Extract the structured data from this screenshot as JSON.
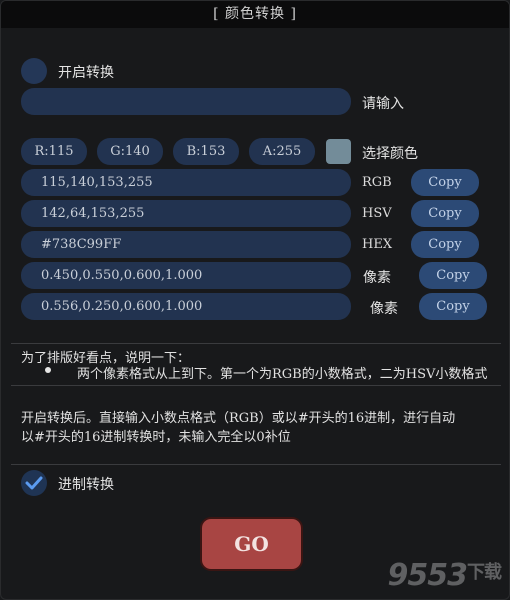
{
  "window": {
    "title": "[ 颜色转换 ]"
  },
  "input_section": {
    "toggle_label": "开启转换",
    "toggle_on": false,
    "input_value": "",
    "input_label": "请输入"
  },
  "channels": {
    "r": "R:115",
    "g": "G:140",
    "b": "B:153",
    "a": "A:255",
    "swatch_color": "#738C99",
    "pick_label": "选择颜色"
  },
  "formats": [
    {
      "value": "115,140,153,255",
      "label": "RGB",
      "copy": "Copy"
    },
    {
      "value": "142,64,153,255",
      "label": "HSV",
      "copy": "Copy"
    },
    {
      "value": "#738C99FF",
      "label": "HEX",
      "copy": "Copy"
    },
    {
      "value": "0.450,0.550,0.600,1.000",
      "label": "像素",
      "copy": "Copy"
    },
    {
      "value": "0.556,0.250,0.600,1.000",
      "label": "像素",
      "copy": "Copy"
    }
  ],
  "notes": {
    "heading": "为了排版好看点，说明一下：",
    "bullet": "两个像素格式从上到下。第一个为RGB的小数格式，二为HSV小数格式",
    "line1": "开启转换后。直接输入小数点格式（RGB）或以#开头的16进制，进行自动",
    "line2": "以#开头的16进制转换时，未输入完全以0补位"
  },
  "hex_toggle": {
    "label": "进制转换",
    "checked": true
  },
  "go_button": "GO",
  "watermark": {
    "main": "9553",
    "sub": "下载"
  }
}
